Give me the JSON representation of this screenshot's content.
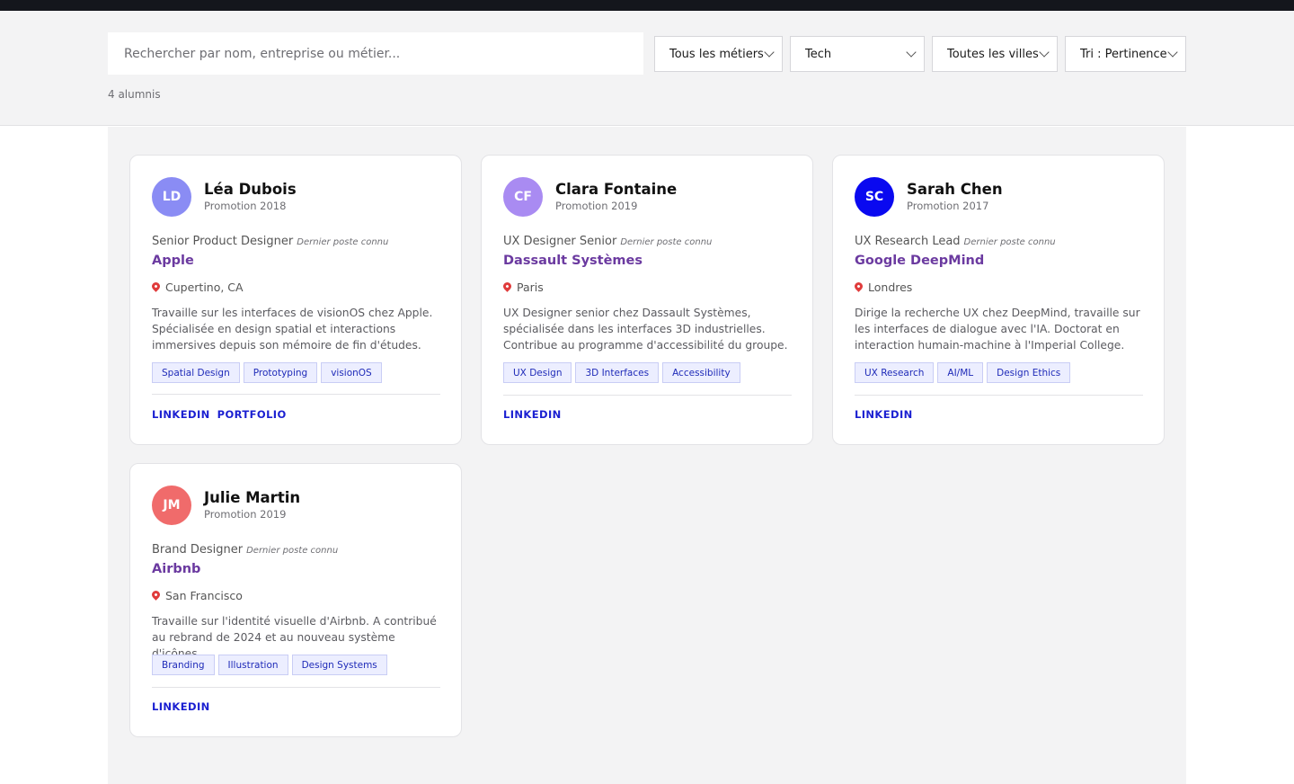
{
  "search": {
    "placeholder": "Rechercher par nom, entreprise ou métier..."
  },
  "filters": [
    {
      "label": "Tous les métiers"
    },
    {
      "label": "Tech"
    },
    {
      "label": "Toutes les villes"
    },
    {
      "label": "Tri : Pertinence"
    }
  ],
  "result_count": "4 alumnis",
  "cards": [
    {
      "initials": "LD",
      "avatar_color": "#8a8cf4",
      "name": "Léa Dubois",
      "promotion": "Promotion 2018",
      "role": "Senior Product Designer",
      "role_note": "Dernier poste connu",
      "company": "Apple",
      "location": "Cupertino, CA",
      "description": "Travaille sur les interfaces de visionOS chez Apple. Spécialisée en design spatial et interactions immersives depuis son mémoire de fin d'études.",
      "tags": [
        "Spatial Design",
        "Prototyping",
        "visionOS"
      ],
      "links": [
        "LINKEDIN",
        "PORTFOLIO"
      ]
    },
    {
      "initials": "CF",
      "avatar_color": "#a98bf2",
      "name": "Clara Fontaine",
      "promotion": "Promotion 2019",
      "role": "UX Designer Senior",
      "role_note": "Dernier poste connu",
      "company": "Dassault Systèmes",
      "location": "Paris",
      "description": "UX Designer senior chez Dassault Systèmes, spécialisée dans les interfaces 3D industrielles. Contribue au programme d'accessibilité du groupe.",
      "tags": [
        "UX Design",
        "3D Interfaces",
        "Accessibility"
      ],
      "links": [
        "LINKEDIN"
      ]
    },
    {
      "initials": "SC",
      "avatar_color": "#0a09f0",
      "name": "Sarah Chen",
      "promotion": "Promotion 2017",
      "role": "UX Research Lead",
      "role_note": "Dernier poste connu",
      "company": "Google DeepMind",
      "location": "Londres",
      "description": "Dirige la recherche UX chez DeepMind, travaille sur les interfaces de dialogue avec l'IA. Doctorat en interaction humain-machine à l'Imperial College.",
      "tags": [
        "UX Research",
        "AI/ML",
        "Design Ethics"
      ],
      "links": [
        "LINKEDIN"
      ]
    },
    {
      "initials": "JM",
      "avatar_color": "#f06b6b",
      "name": "Julie Martin",
      "promotion": "Promotion 2019",
      "role": "Brand Designer",
      "role_note": "Dernier poste connu",
      "company": "Airbnb",
      "location": "San Francisco",
      "description": "Travaille sur l'identité visuelle d'Airbnb. A contribué au rebrand de 2024 et au nouveau système d'icônes.",
      "tags": [
        "Branding",
        "Illustration",
        "Design Systems"
      ],
      "links": [
        "LINKEDIN"
      ]
    }
  ]
}
